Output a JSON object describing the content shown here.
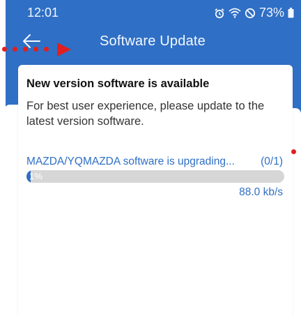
{
  "status_bar": {
    "time": "12:01",
    "battery_text": "73%"
  },
  "header": {
    "title": "Software Update"
  },
  "card": {
    "title": "New version software is available",
    "description": "For best user experience, please update to the latest version software.",
    "upgrade_text": "MAZDA/YQMAZDA software is upgrading...",
    "upgrade_count": "(0/1)",
    "progress": {
      "label": "1%",
      "value": 0.01
    },
    "speed": "88.0 kb/s"
  },
  "colors": {
    "primary": "#2f6fc5",
    "annotation": "#e02020",
    "track": "#d6d6d6"
  },
  "icons": [
    "back-arrow-icon",
    "alarm-icon",
    "wifi-icon",
    "do-not-disturb-icon",
    "battery-icon"
  ]
}
